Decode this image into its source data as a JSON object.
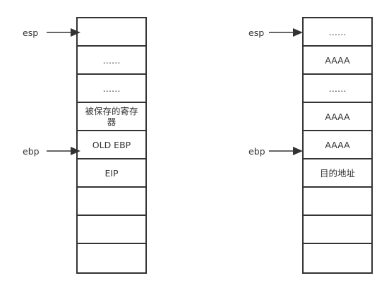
{
  "left_stack": {
    "cells": [
      "",
      "……",
      "……",
      "被保存的寄存器",
      "OLD EBP",
      "EIP",
      "",
      "",
      ""
    ]
  },
  "right_stack": {
    "cells": [
      "……",
      "AAAA",
      "……",
      "AAAA",
      "AAAA",
      "目的地址",
      "",
      "",
      ""
    ]
  },
  "pointers": {
    "left_esp": "esp",
    "left_ebp": "ebp",
    "right_esp": "esp",
    "right_ebp": "ebp"
  }
}
